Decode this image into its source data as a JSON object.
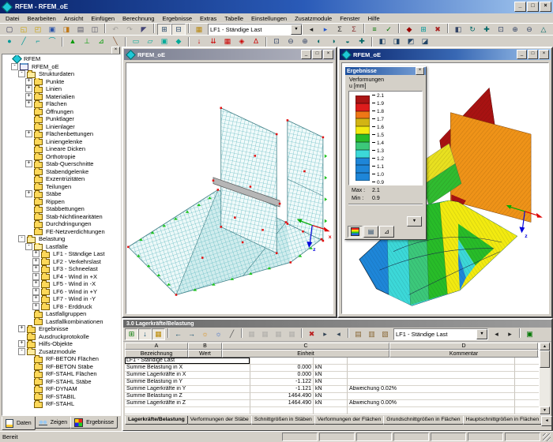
{
  "titlebar": {
    "title": "RFEM - RFEM_oE"
  },
  "icons": {
    "minimize": "_",
    "maximize": "□",
    "close": "×",
    "dropdown": "▼",
    "up": "▲",
    "down": "▼",
    "left": "◄",
    "right": "►"
  },
  "menubar": [
    "Datei",
    "Bearbeiten",
    "Ansicht",
    "Einfügen",
    "Berechnung",
    "Ergebnisse",
    "Extras",
    "Tabelle",
    "Einstellungen",
    "Zusatzmodule",
    "Fenster",
    "Hilfe"
  ],
  "toolbar1_combo": "LF1 - Ständige Last",
  "toolbar1a": [
    {
      "name": "new-icon",
      "g": "▢",
      "c": "#335"
    },
    {
      "name": "open-icon",
      "g": "◱",
      "c": "#c8a000"
    },
    {
      "name": "open-project-icon",
      "g": "◰",
      "c": "#c8a000"
    },
    {
      "name": "save-icon",
      "g": "▣",
      "c": "#2a52a8"
    },
    {
      "name": "save-as-icon",
      "g": "◨",
      "c": "#c07818"
    },
    {
      "name": "print-icon",
      "g": "▤",
      "c": "#556"
    },
    {
      "name": "print-preview-icon",
      "g": "◫",
      "c": "#556"
    },
    {
      "sep": true
    },
    {
      "name": "undo-icon",
      "g": "↶",
      "c": "#667",
      "disabled": true
    },
    {
      "name": "redo-icon",
      "g": "↷",
      "c": "#667",
      "disabled": true
    },
    {
      "name": "input-mode-icon",
      "g": "◤",
      "c": "#447"
    },
    {
      "sep": true
    },
    {
      "name": "table-show-icon",
      "g": "⊞",
      "c": "#246",
      "pressed": true
    },
    {
      "name": "navigator-show-icon",
      "g": "⊟",
      "c": "#246",
      "pressed": true
    },
    {
      "sep": true
    },
    {
      "name": "loadcase-manager-icon",
      "g": "▦",
      "c": "#b8860b"
    }
  ],
  "toolbar1b": [
    {
      "name": "previous-loadcase-icon",
      "g": "◂",
      "c": "#222"
    },
    {
      "name": "next-loadcase-icon",
      "g": "▸",
      "c": "#2255cc"
    },
    {
      "name": "load-group-icon",
      "g": "Σ",
      "c": "#333"
    },
    {
      "name": "load-combination-icon",
      "g": "Σ",
      "c": "#833"
    },
    {
      "sep": true
    },
    {
      "name": "calculation-icon",
      "g": "≡",
      "c": "#070"
    },
    {
      "name": "check-data-icon",
      "g": "✓",
      "c": "#070"
    },
    {
      "sep": true
    },
    {
      "name": "show-results-icon",
      "g": "◆",
      "c": "#900"
    },
    {
      "name": "mesh-icon",
      "g": "⊞",
      "c": "#099"
    },
    {
      "name": "delete-results-icon",
      "g": "✖",
      "c": "#a22"
    },
    {
      "sep": true
    },
    {
      "name": "new-window-icon",
      "g": "◧",
      "c": "#346"
    },
    {
      "name": "refresh-icon",
      "g": "↻",
      "c": "#066"
    },
    {
      "name": "move-view-icon",
      "g": "✚",
      "c": "#066"
    },
    {
      "name": "zoom-window-icon",
      "g": "⊡",
      "c": "#346"
    },
    {
      "name": "zoom-in-icon",
      "g": "⊕",
      "c": "#346"
    },
    {
      "name": "zoom-out-icon",
      "g": "⊖",
      "c": "#346"
    },
    {
      "name": "isometric-view-icon",
      "g": "△",
      "c": "#066"
    }
  ],
  "toolbar2": [
    {
      "name": "node-tool-icon",
      "g": "●",
      "c": "#099"
    },
    {
      "name": "line-tool-icon",
      "g": "╱",
      "c": "#099"
    },
    {
      "name": "polyline-tool-icon",
      "g": "⌐",
      "c": "#099"
    },
    {
      "name": "arc-tool-icon",
      "g": "⌒",
      "c": "#099"
    },
    {
      "sep": true
    },
    {
      "name": "nodal-support-icon",
      "g": "▲",
      "c": "#090"
    },
    {
      "name": "line-support-icon",
      "g": "⊥",
      "c": "#090"
    },
    {
      "name": "line-hinge-icon",
      "g": "⊿",
      "c": "#090"
    },
    {
      "name": "member-tool-icon",
      "g": "╲",
      "c": "#853"
    },
    {
      "sep": true
    },
    {
      "name": "surface-tool-icon",
      "g": "▭",
      "c": "#0a9"
    },
    {
      "name": "surface-nurbs-icon",
      "g": "▱",
      "c": "#0a9"
    },
    {
      "name": "opening-tool-icon",
      "g": "▣",
      "c": "#0a9"
    },
    {
      "name": "solid-tool-icon",
      "g": "◆",
      "c": "#0a9"
    },
    {
      "sep": true
    },
    {
      "name": "nodal-load-icon",
      "g": "↓",
      "c": "#c00"
    },
    {
      "name": "line-load-icon",
      "g": "⇊",
      "c": "#c00"
    },
    {
      "name": "surface-load-icon",
      "g": "▦",
      "c": "#c00"
    },
    {
      "name": "free-load-icon",
      "g": "◈",
      "c": "#c00"
    },
    {
      "name": "load-generator-icon",
      "g": "∆",
      "c": "#c00"
    },
    {
      "sep": true
    },
    {
      "name": "zoom-window2-icon",
      "g": "⊡",
      "c": "#346"
    },
    {
      "name": "zoom-out2-icon",
      "g": "⊖",
      "c": "#346"
    },
    {
      "name": "zoom-in2-icon",
      "g": "⊕",
      "c": "#346"
    },
    {
      "name": "rotate-view-x-icon",
      "g": "◐",
      "c": "#066"
    },
    {
      "name": "rotate-view-y-icon",
      "g": "◑",
      "c": "#066"
    },
    {
      "name": "rotate-view-z-icon",
      "g": "◒",
      "c": "#066"
    },
    {
      "name": "pan-view-icon",
      "g": "✚",
      "c": "#066"
    },
    {
      "sep": true
    },
    {
      "name": "view-x-icon",
      "g": "◧",
      "c": "#246"
    },
    {
      "name": "view-y-icon",
      "g": "◨",
      "c": "#246"
    },
    {
      "name": "view-z-icon",
      "g": "◩",
      "c": "#246"
    },
    {
      "name": "perspective-icon",
      "g": "◪",
      "c": "#246"
    }
  ],
  "navigator": {
    "tabs": [
      {
        "label": "Daten",
        "i": "data",
        "active": true
      },
      {
        "label": "Zeigen",
        "i": "show"
      },
      {
        "label": "Ergebnisse",
        "i": "results"
      }
    ],
    "tree": [
      {
        "label": "RFEM",
        "level": 0,
        "x": "",
        "i": "app"
      },
      {
        "label": "RFEM_oE",
        "level": 1,
        "x": "-",
        "i": "model"
      },
      {
        "label": "Strukturdaten",
        "level": 2,
        "x": "-",
        "i": "fo"
      },
      {
        "label": "Punkte",
        "level": 3,
        "x": "+",
        "i": "f"
      },
      {
        "label": "Linien",
        "level": 3,
        "x": "+",
        "i": "f"
      },
      {
        "label": "Materialien",
        "level": 3,
        "x": "+",
        "i": "f"
      },
      {
        "label": "Flächen",
        "level": 3,
        "x": "+",
        "i": "f"
      },
      {
        "label": "Öffnungen",
        "level": 3,
        "x": "",
        "i": "f"
      },
      {
        "label": "Punktlager",
        "level": 3,
        "x": "",
        "i": "f"
      },
      {
        "label": "Linienlager",
        "level": 3,
        "x": "",
        "i": "f"
      },
      {
        "label": "Flächenbettungen",
        "level": 3,
        "x": "+",
        "i": "f"
      },
      {
        "label": "Liniengelenke",
        "level": 3,
        "x": "",
        "i": "f"
      },
      {
        "label": "Lineare Dicken",
        "level": 3,
        "x": "",
        "i": "f"
      },
      {
        "label": "Orthotropie",
        "level": 3,
        "x": "",
        "i": "f"
      },
      {
        "label": "Stab-Querschnitte",
        "level": 3,
        "x": "+",
        "i": "f"
      },
      {
        "label": "Stabendgelenke",
        "level": 3,
        "x": "",
        "i": "f"
      },
      {
        "label": "Exzentrizitäten",
        "level": 3,
        "x": "",
        "i": "f"
      },
      {
        "label": "Teilungen",
        "level": 3,
        "x": "",
        "i": "f"
      },
      {
        "label": "Stäbe",
        "level": 3,
        "x": "+",
        "i": "f"
      },
      {
        "label": "Rippen",
        "level": 3,
        "x": "",
        "i": "f"
      },
      {
        "label": "Stabbettungen",
        "level": 3,
        "x": "",
        "i": "f"
      },
      {
        "label": "Stab-Nichtlinearitäten",
        "level": 3,
        "x": "",
        "i": "f"
      },
      {
        "label": "Durchdringungen",
        "level": 3,
        "x": "",
        "i": "f"
      },
      {
        "label": "FE-Netzverdichtungen",
        "level": 3,
        "x": "",
        "i": "f"
      },
      {
        "label": "Belastung",
        "level": 2,
        "x": "-",
        "i": "fo"
      },
      {
        "label": "Lastfälle",
        "level": 3,
        "x": "-",
        "i": "fo"
      },
      {
        "label": "LF1 - Ständige Last",
        "level": 4,
        "x": "+",
        "i": "f"
      },
      {
        "label": "LF2 - Verkehrslast",
        "level": 4,
        "x": "+",
        "i": "f"
      },
      {
        "label": "LF3 - Schneelast",
        "level": 4,
        "x": "+",
        "i": "f"
      },
      {
        "label": "LF4 - Wind in +X",
        "level": 4,
        "x": "+",
        "i": "f"
      },
      {
        "label": "LF5 - Wind in -X",
        "level": 4,
        "x": "+",
        "i": "f"
      },
      {
        "label": "LF6 - Wind in +Y",
        "level": 4,
        "x": "+",
        "i": "f"
      },
      {
        "label": "LF7 - Wind in -Y",
        "level": 4,
        "x": "+",
        "i": "f"
      },
      {
        "label": "LF8 - Erddruck",
        "level": 4,
        "x": "+",
        "i": "f"
      },
      {
        "label": "Lastfallgruppen",
        "level": 3,
        "x": "",
        "i": "f"
      },
      {
        "label": "Lastfallkombinationen",
        "level": 3,
        "x": "",
        "i": "f"
      },
      {
        "label": "Ergebnisse",
        "level": 2,
        "x": "+",
        "i": "f"
      },
      {
        "label": "Ausdruckprotokolle",
        "level": 2,
        "x": "",
        "i": "f"
      },
      {
        "label": "Hilfs-Objekte",
        "level": 2,
        "x": "+",
        "i": "f"
      },
      {
        "label": "Zusatzmodule",
        "level": 2,
        "x": "-",
        "i": "fo"
      },
      {
        "label": "RF-BETON Flächen",
        "level": 3,
        "x": "",
        "i": "f"
      },
      {
        "label": "RF-BETON Stäbe",
        "level": 3,
        "x": "",
        "i": "f"
      },
      {
        "label": "RF-STAHL Flächen",
        "level": 3,
        "x": "",
        "i": "f"
      },
      {
        "label": "RF-STAHL Stäbe",
        "level": 3,
        "x": "",
        "i": "f"
      },
      {
        "label": "RF-DYNAM",
        "level": 3,
        "x": "",
        "i": "f"
      },
      {
        "label": "RF-STABIL",
        "level": 3,
        "x": "",
        "i": "f"
      },
      {
        "label": "RF-STAHL",
        "level": 3,
        "x": "",
        "i": "f"
      }
    ]
  },
  "views": {
    "left_title": "RFEM_oE",
    "right_title": "RFEM_oE",
    "axis_x": "x",
    "axis_z": "z"
  },
  "results_panel": {
    "title": "Ergebnisse",
    "field": "Verformungen",
    "unit": "u [mm]",
    "scale_labels": [
      "2.1",
      "1.9",
      "1.8",
      "1.7",
      "1.6",
      "1.5",
      "1.4",
      "1.3",
      "1.2",
      "1.1",
      "1.0",
      "0.9"
    ],
    "scale_colors": [
      "#aa1414",
      "#dd1c1c",
      "#ee7716",
      "#d2b414",
      "#f2ea10",
      "#28bc28",
      "#3cc87a",
      "#3cd8d8",
      "#1e86d8",
      "#1e86d8",
      "#1e86d8"
    ],
    "max_label": "Max :",
    "max_value": "2.1",
    "min_label": "Min :",
    "min_value": "0.9"
  },
  "table_panel": {
    "title": "3.0 Lagerkräfte/Belastung",
    "combo": "LF1 - Ständige Last",
    "toolbar_a": [
      {
        "name": "table-view-icon",
        "g": "⊞",
        "c": "#070",
        "pressed": true
      },
      {
        "name": "sync-selection-icon",
        "g": "↓",
        "c": "#046",
        "pressed": true
      },
      {
        "name": "goto-table-icon",
        "g": "▦",
        "c": "#b80",
        "pressed": true
      },
      {
        "sep": true
      },
      {
        "name": "back-icon",
        "g": "←",
        "c": "#046"
      },
      {
        "name": "forward-icon",
        "g": "→",
        "c": "#046"
      },
      {
        "name": "filter-on-icon",
        "g": "☼",
        "c": "#d80"
      },
      {
        "name": "filter-result-icon",
        "g": "☼",
        "c": "#36c"
      },
      {
        "name": "interpolate-icon",
        "g": "╱",
        "c": "#555"
      },
      {
        "sep": true
      },
      {
        "name": "calc-table1-icon",
        "g": "▦",
        "c": "#888",
        "disabled": true
      },
      {
        "name": "calc-table2-icon",
        "g": "▦",
        "c": "#888",
        "disabled": true
      },
      {
        "name": "calc-table3-icon",
        "g": "▦",
        "c": "#888",
        "disabled": true
      },
      {
        "name": "calc-table4-icon",
        "g": "▦",
        "c": "#888",
        "disabled": true
      },
      {
        "sep": true
      },
      {
        "name": "delete-cells-icon",
        "g": "✖",
        "c": "#b22"
      },
      {
        "name": "insert-row-icon",
        "g": "▸",
        "c": "#345"
      },
      {
        "name": "delete-row-icon",
        "g": "◂",
        "c": "#345"
      },
      {
        "sep": true
      },
      {
        "name": "copy-row-icon",
        "g": "▤",
        "c": "#863"
      },
      {
        "name": "import-table-icon",
        "g": "▥",
        "c": "#863"
      },
      {
        "name": "export-table-icon",
        "g": "▧",
        "c": "#863"
      }
    ],
    "toolbar_b": [
      {
        "name": "prev-table-loadcase-icon",
        "g": "◂",
        "c": "#222"
      },
      {
        "name": "next-table-loadcase-icon",
        "g": "▸",
        "c": "#222"
      },
      {
        "sep": true
      },
      {
        "name": "table-fullscreen-icon",
        "g": "▣",
        "c": "#070"
      }
    ],
    "column_letters": [
      "A",
      "B",
      "C",
      "D",
      ""
    ],
    "headers": [
      "Bezeichnung",
      "Wert",
      "Einheit",
      "Kommentar",
      ""
    ],
    "rows": [
      {
        "bez": "LF1 - Ständige Last",
        "wert": "",
        "einh": "",
        "kom": "",
        "sel": true
      },
      {
        "bez": "Summe Belastung in X",
        "wert": "0.000",
        "einh": "kN",
        "kom": ""
      },
      {
        "bez": "Summe Lagerkräfte in X",
        "wert": "0.000",
        "einh": "kN",
        "kom": ""
      },
      {
        "bez": "Summe Belastung in Y",
        "wert": "-1.122",
        "einh": "kN",
        "kom": ""
      },
      {
        "bez": "Summe Lagerkräfte in Y",
        "wert": "-1.121",
        "einh": "kN",
        "kom": "Abweichung 0.02%"
      },
      {
        "bez": "Summe Belastung in Z",
        "wert": "1464.490",
        "einh": "kN",
        "kom": ""
      },
      {
        "bez": "Summe Lagerkräfte in Z",
        "wert": "1464.490",
        "einh": "kN",
        "kom": "Abweichung 0.00%"
      },
      {
        "bez": "",
        "wert": "",
        "einh": "",
        "kom": ""
      }
    ],
    "tabs": [
      {
        "label": "Lagerkräfte/Belastung",
        "active": true
      },
      {
        "label": "Verformungen der Stäbe"
      },
      {
        "label": "Schnittgrößen in Stäben"
      },
      {
        "label": "Verformungen der Flächen"
      },
      {
        "label": "Grundschnittgrößen in Flächen"
      },
      {
        "label": "Hauptschnittgrößen in Flächen"
      }
    ]
  },
  "statusbar": {
    "text": "Bereit",
    "boxes": [
      "",
      "",
      "",
      "",
      "",
      "",
      ""
    ]
  }
}
